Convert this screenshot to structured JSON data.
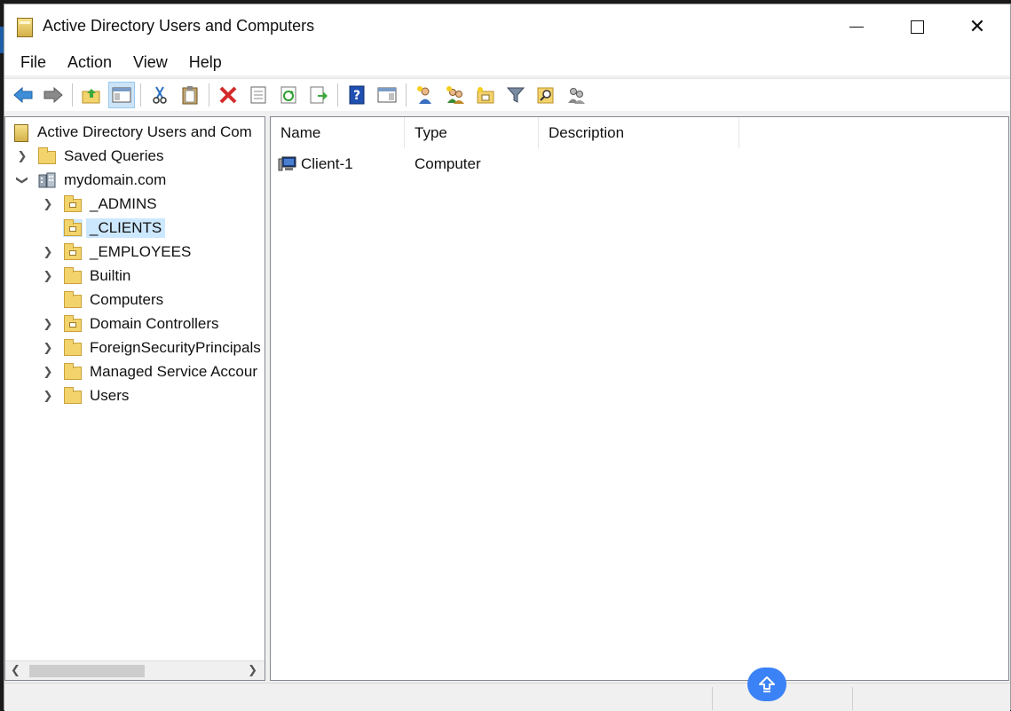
{
  "window": {
    "title": "Active Directory Users and Computers",
    "controls": {
      "minimize": "minimize",
      "maximize": "maximize",
      "close": "✕"
    }
  },
  "menubar": [
    "File",
    "Action",
    "View",
    "Help"
  ],
  "toolbar": {
    "icons": [
      "back-arrow-icon",
      "forward-arrow-icon",
      "up-folder-icon",
      "show-console-tree-icon",
      "cut-icon",
      "paste-icon",
      "delete-icon",
      "properties-icon",
      "refresh-icon",
      "export-list-icon",
      "help-icon",
      "action-pane-icon",
      "new-user-icon",
      "new-group-icon",
      "new-ou-icon",
      "filter-icon",
      "find-icon",
      "add-to-group-icon"
    ]
  },
  "tree": {
    "root": "Active Directory Users and Com",
    "saved_queries": "Saved Queries",
    "domain": "mydomain.com",
    "children": [
      {
        "label": "_ADMINS",
        "icon": "ou-folder-icon",
        "expandable": true,
        "selected": false
      },
      {
        "label": "_CLIENTS",
        "icon": "ou-folder-icon",
        "expandable": false,
        "selected": true
      },
      {
        "label": "_EMPLOYEES",
        "icon": "ou-folder-icon",
        "expandable": true,
        "selected": false
      },
      {
        "label": "Builtin",
        "icon": "folder-icon",
        "expandable": true,
        "selected": false
      },
      {
        "label": "Computers",
        "icon": "folder-icon",
        "expandable": false,
        "selected": false
      },
      {
        "label": "Domain Controllers",
        "icon": "ou-folder-icon",
        "expandable": true,
        "selected": false
      },
      {
        "label": "ForeignSecurityPrincipals",
        "icon": "folder-icon",
        "expandable": true,
        "selected": false
      },
      {
        "label": "Managed Service Accour",
        "icon": "folder-icon",
        "expandable": true,
        "selected": false
      },
      {
        "label": "Users",
        "icon": "folder-icon",
        "expandable": true,
        "selected": false
      }
    ]
  },
  "list": {
    "columns": [
      "Name",
      "Type",
      "Description"
    ],
    "rows": [
      {
        "name": "Client-1",
        "type": "Computer",
        "description": "",
        "icon": "computer-icon"
      }
    ]
  },
  "colors": {
    "selection": "#cce8ff",
    "folder": "#f3d36b",
    "fab": "#3b82f6"
  }
}
